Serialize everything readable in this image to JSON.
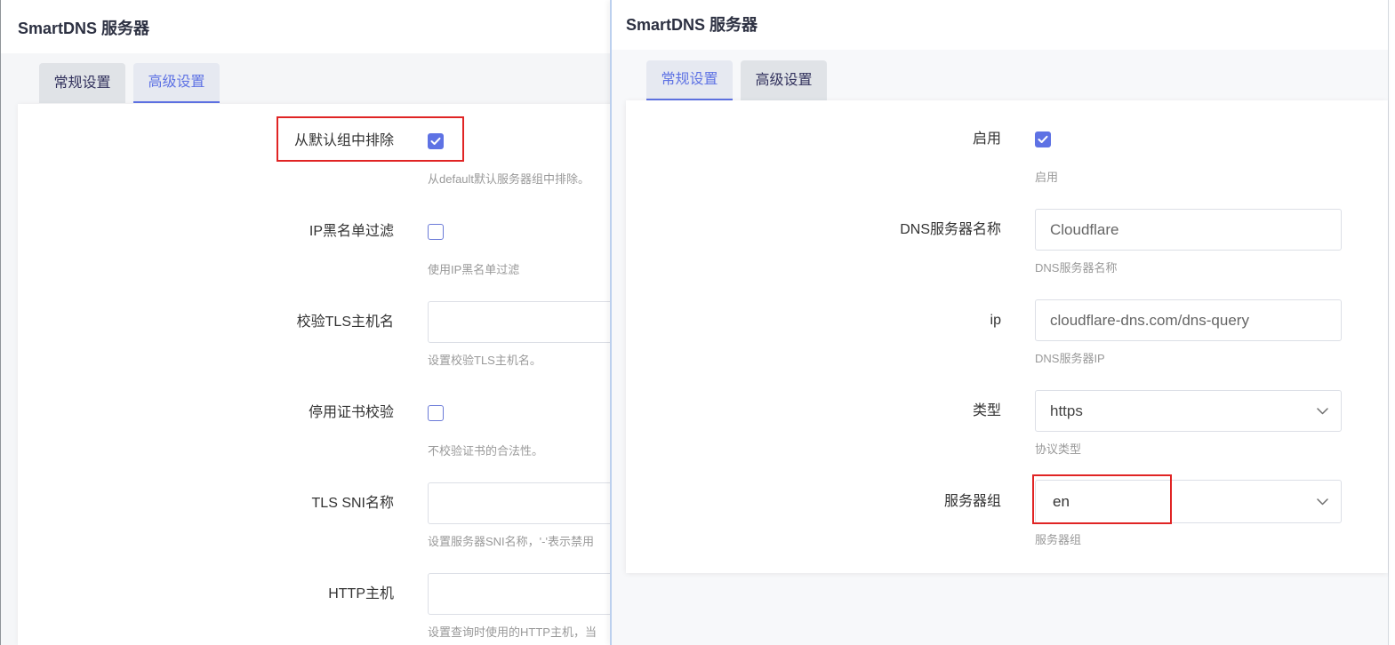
{
  "colors": {
    "accent": "#5e72e4",
    "highlight": "#e02424"
  },
  "left_panel": {
    "title": "SmartDNS 服务器",
    "tabs": [
      {
        "label": "常规设置",
        "active": false
      },
      {
        "label": "高级设置",
        "active": true
      }
    ],
    "fields": [
      {
        "label": "从默认组中排除",
        "type": "checkbox",
        "checked": true,
        "highlighted": true,
        "description": "从default默认服务器组中排除。"
      },
      {
        "label": "IP黑名单过滤",
        "type": "checkbox",
        "checked": false,
        "description": "使用IP黑名单过滤"
      },
      {
        "label": "校验TLS主机名",
        "type": "text",
        "value": "",
        "description": "设置校验TLS主机名。"
      },
      {
        "label": "停用证书校验",
        "type": "checkbox",
        "checked": false,
        "description": "不校验证书的合法性。"
      },
      {
        "label": "TLS SNI名称",
        "type": "text",
        "value": "",
        "description": "设置服务器SNI名称，'-'表示禁用"
      },
      {
        "label": "HTTP主机",
        "type": "text",
        "value": "",
        "description": "设置查询时使用的HTTP主机，当"
      }
    ]
  },
  "right_panel": {
    "title": "SmartDNS 服务器",
    "tabs": [
      {
        "label": "常规设置",
        "active": true
      },
      {
        "label": "高级设置",
        "active": false
      }
    ],
    "fields": [
      {
        "label": "启用",
        "type": "checkbox",
        "checked": true,
        "description": "启用"
      },
      {
        "label": "DNS服务器名称",
        "type": "text",
        "value": "Cloudflare",
        "description": "DNS服务器名称"
      },
      {
        "label": "ip",
        "type": "text",
        "value": "cloudflare-dns.com/dns-query",
        "description": "DNS服务器IP"
      },
      {
        "label": "类型",
        "type": "select",
        "value": "https",
        "description": "协议类型"
      },
      {
        "label": "服务器组",
        "type": "select",
        "value": "en",
        "highlighted": true,
        "description": "服务器组"
      }
    ]
  }
}
